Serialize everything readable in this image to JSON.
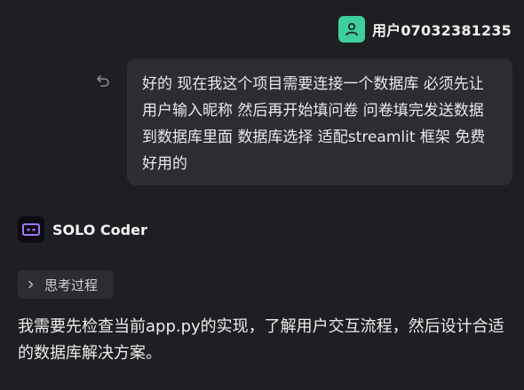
{
  "user": {
    "name": "用户07032381235",
    "avatar_color": "#3ecf9b"
  },
  "message": {
    "text": "好的 现在我这个项目需要连接一个数据库 必须先让用户输入昵称 然后再开始填问卷 问卷填完发送数据到数据库里面 数据库选择 适配streamlit 框架 免费好用的"
  },
  "assistant": {
    "name": "SOLO Coder",
    "logo_icon": "bot-icon",
    "accent_color": "#a277ff"
  },
  "thinking": {
    "label": "思考过程",
    "icon": "chevron-right-icon"
  },
  "response": {
    "text": "我需要先检查当前app.py的实现，了解用户交互流程，然后设计合适的数据库解决方案。"
  }
}
